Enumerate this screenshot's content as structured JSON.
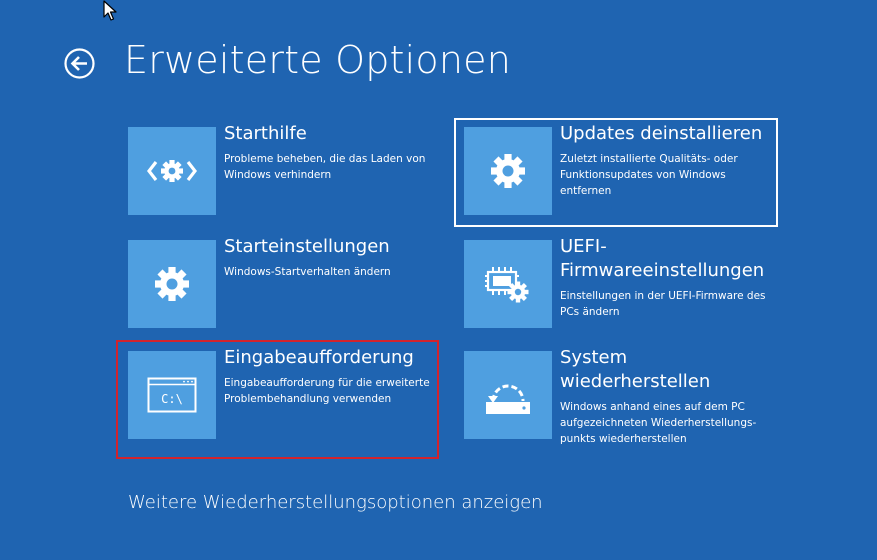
{
  "header": {
    "title": "Erweiterte Optionen",
    "back_icon": "back-arrow-circle-icon"
  },
  "tiles": [
    {
      "title": "Starthilfe",
      "description": "Probleme beheben, die das Laden von\nWindows verhindern",
      "icon": "code-gear-icon"
    },
    {
      "title": "Updates deinstallieren",
      "description": "Zuletzt installierte Qualitäts- oder\nFunktionsupdates von Windows\nentfernen",
      "icon": "gear-icon"
    },
    {
      "title": "Starteinstellungen",
      "description": "Windows-Startverhalten ändern",
      "icon": "gear-icon"
    },
    {
      "title": "UEFI-\nFirmwareeinstellungen",
      "description": "Einstellungen in der UEFI-Firmware des\nPCs ändern",
      "icon": "chip-gear-icon"
    },
    {
      "title": "Eingabeaufforderung",
      "description": "Eingabeaufforderung für die erweiterte\nProblembehandlung verwenden",
      "icon": "command-prompt-icon",
      "icon_text": "C:\\"
    },
    {
      "title": "System\nwiederherstellen",
      "description": "Windows anhand eines auf dem PC\naufgezeichneten Wiederherstellungs-\npunkts wiederherstellen",
      "icon": "drive-restore-icon"
    }
  ],
  "footer": {
    "more_options": "Weitere Wiederherstellungsoptionen anzeigen"
  },
  "colors": {
    "background": "#1f64b1",
    "tile": "#4f9fe0",
    "highlight_red": "#d1232c",
    "focus_white": "#ffffff"
  }
}
